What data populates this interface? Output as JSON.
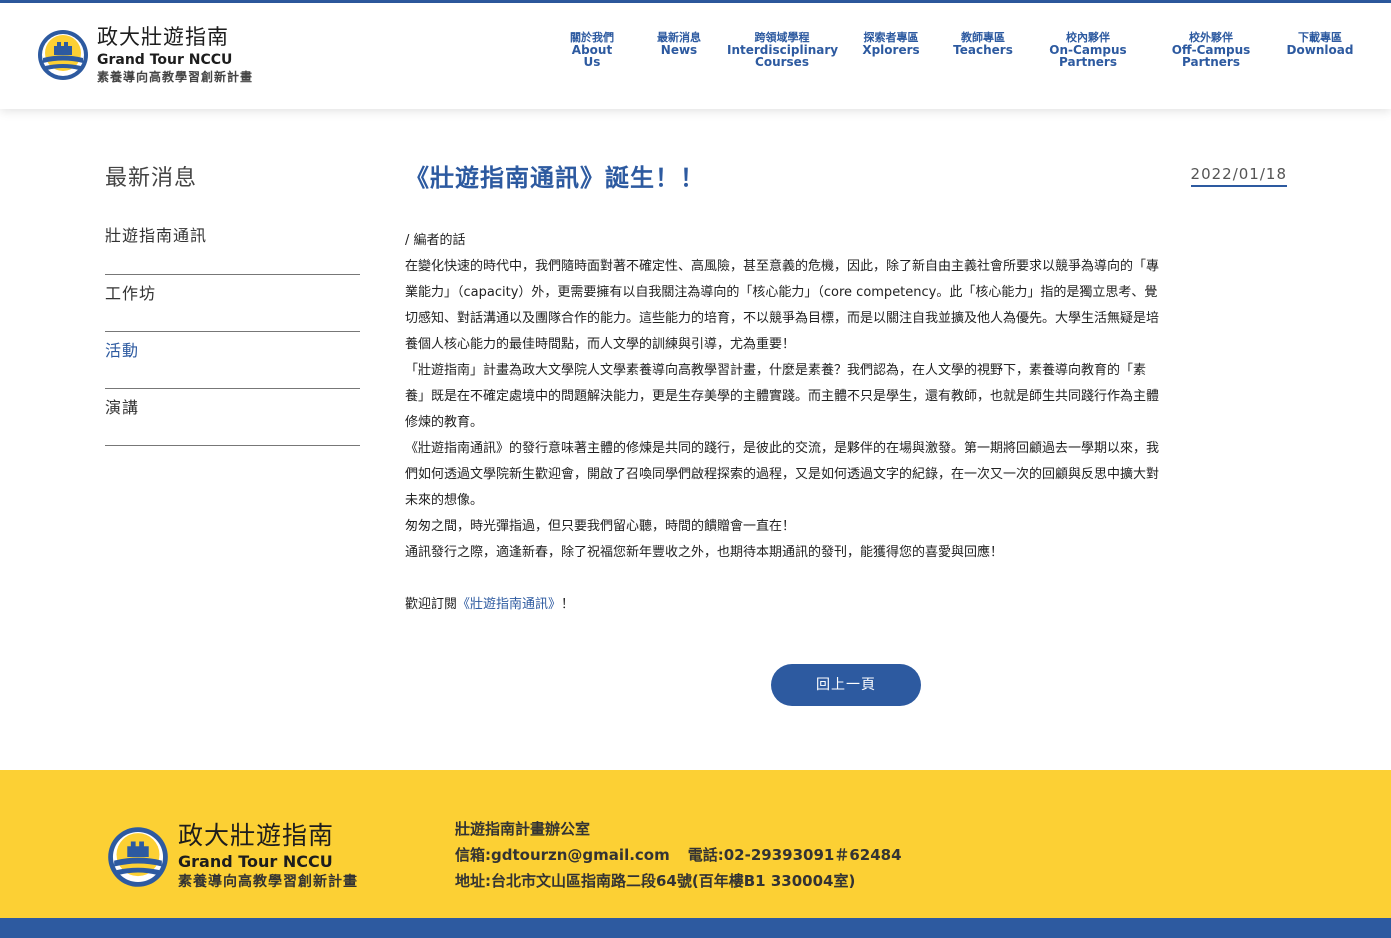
{
  "brand": {
    "zh": "政大壯遊指南",
    "en": "Grand Tour NCCU",
    "sub": "素養導向高教學習創新計畫"
  },
  "nav": [
    {
      "zh": "關於我們",
      "en": "About Us"
    },
    {
      "zh": "最新消息",
      "en": "News"
    },
    {
      "zh": "跨領域學程",
      "en": "Interdisciplinary\nCourses"
    },
    {
      "zh": "探索者專區",
      "en": "Xplorers"
    },
    {
      "zh": "教師專區",
      "en": "Teachers"
    },
    {
      "zh": "校內夥伴",
      "en": "On-Campus\nPartners"
    },
    {
      "zh": "校外夥伴",
      "en": "Off-Campus\nPartners"
    },
    {
      "zh": "下載專區",
      "en": "Download"
    }
  ],
  "sidebar": {
    "title": "最新消息",
    "items": [
      {
        "label": "壯遊指南通訊"
      },
      {
        "label": "工作坊"
      },
      {
        "label": "活動"
      },
      {
        "label": "演講"
      }
    ]
  },
  "article": {
    "title": "《壯遊指南通訊》誕生！！",
    "date": "2022/01/18",
    "lines": [
      "/ 編者的話",
      "在變化快速的時代中，我們隨時面對著不確定性、高風險，甚至意義的危機，因此，除了新自由主義社會所要求以競爭為導向的「專",
      "業能力」（capacity）外，更需要擁有以自我關注為導向的「核心能力」（core competency。此「核心能力」指的是獨立思考、覺",
      "切感知、對話溝通以及團隊合作的能力。這些能力的培育，不以競爭為目標，而是以關注自我並擴及他人為優先。大學生活無疑是培",
      "養個人核心能力的最佳時間點，而人文學的訓練與引導，尤為重要！",
      "「壯遊指南」計畫為政大文學院人文學素養導向高教學習計畫，什麼是素養？我們認為，在人文學的視野下，素養導向教育的「素",
      "養」既是在不確定處境中的問題解決能力，更是生存美學的主體實踐。而主體不只是學生，還有教師，也就是師生共同踐行作為主體",
      "修煉的教育。",
      "《壯遊指南通訊》的發行意味著主體的修煉是共同的踐行，是彼此的交流，是夥伴的在場與激發。第一期將回顧過去一學期以來，我",
      "們如何透過文學院新生歡迎會，開啟了召喚同學們啟程探索的過程，又是如何透過文字的紀錄，在一次又一次的回顧與反思中擴大對",
      "未來的想像。",
      "匆匆之間，時光彈指過，但只要我們留心聽，時間的饋贈會一直在！",
      "通訊發行之際，適逢新春，除了祝福您新年豐收之外，也期待本期通訊的發刊，能獲得您的喜愛與回應！"
    ],
    "subscribe_prefix": "歡迎訂閱",
    "subscribe_link": "《壯遊指南通訊》",
    "subscribe_suffix": "！"
  },
  "back_button": "回上一頁",
  "footer": {
    "office": "壯遊指南計畫辦公室",
    "email": "信箱:gdtourzn@gmail.com",
    "phone": "電話:02-29393091＃62484",
    "address": "地址:台北市文山區指南路二段64號(百年樓B1 330004室)"
  },
  "colors": {
    "primary": "#2d5aa0",
    "footer_bg": "#fcd034"
  }
}
